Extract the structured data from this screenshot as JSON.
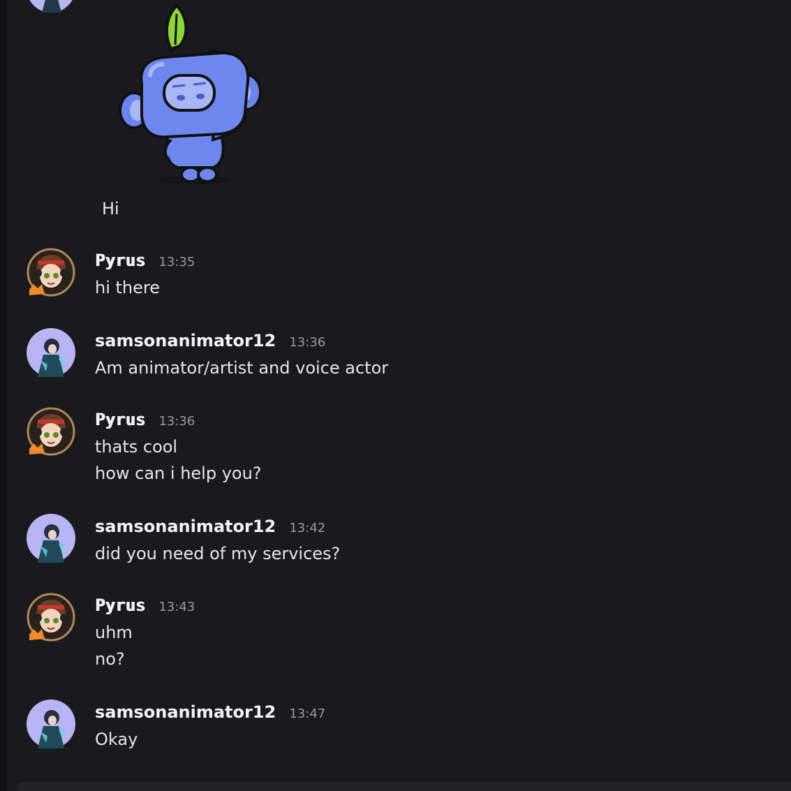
{
  "sticker": {
    "name": "wumpus-wave-sticker"
  },
  "first_message": {
    "text": "Hi"
  },
  "messages": [
    {
      "author": "Pyrus",
      "time": "13:35",
      "lines": [
        "hi there"
      ]
    },
    {
      "author": "samsonanimator12",
      "time": "13:36",
      "lines": [
        "Am animator/artist and voice actor"
      ]
    },
    {
      "author": "Pyrus",
      "time": "13:36",
      "lines": [
        "thats cool",
        "how can i help you?"
      ]
    },
    {
      "author": "samsonanimator12",
      "time": "13:42",
      "lines": [
        "did you need of my services?"
      ]
    },
    {
      "author": "Pyrus",
      "time": "13:43",
      "lines": [
        "uhm",
        "no?"
      ]
    },
    {
      "author": "samsonanimator12",
      "time": "13:47",
      "lines": [
        "Okay"
      ]
    }
  ],
  "colors": {
    "background": "#1a1a1e",
    "text": "#e6e7ea",
    "timestamp": "#949ba4",
    "wumpus": "#7289f0"
  }
}
